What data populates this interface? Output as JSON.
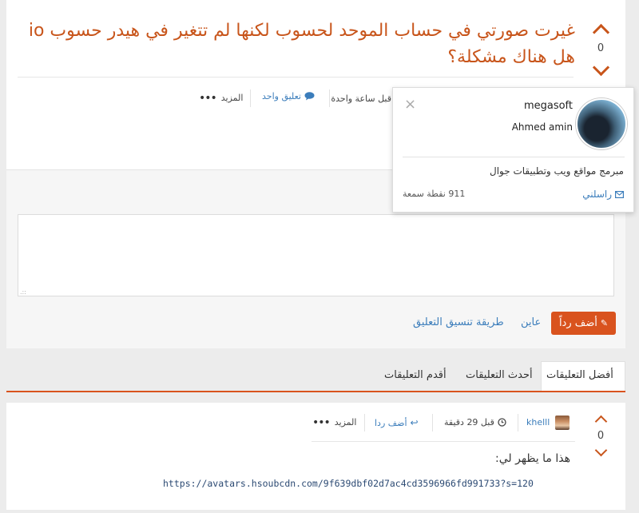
{
  "question": {
    "title": "غيرت صورتي في حساب الموحد لحسوب لكنها لم تتغير في هيدر حسوب io هل هناك مشكلة؟",
    "votes": "0",
    "time": "قبل ساعة واحدة",
    "comments_link": "تعليق واحد",
    "more_label": "المزيد"
  },
  "popup": {
    "username": "megasoft",
    "full_name": "Ahmed amin",
    "bio": "مبرمج مواقع ويب وتطبيقات جوال",
    "points": "911 نقطة سمعة",
    "message_link": "راسلني",
    "close": "×"
  },
  "reply_form": {
    "add_reply_label": "أضف رداً",
    "preview_link": "عاين",
    "format_link": "طريقة تنسيق التعليق",
    "resize_handle": ".::"
  },
  "tabs": {
    "best": "أفضل التعليقات",
    "newest": "أحدث التعليقات",
    "oldest": "أقدم التعليقات"
  },
  "comment": {
    "author": "khelll",
    "time": "قبل 29 دقيقة",
    "reply_label": "أضف ردا",
    "more_label": "المزيد",
    "votes": "0",
    "body": "هذا ما يظهر لي:",
    "link": "https://avatars.hsoubcdn.com/9f639dbf02d7ac4cd3596966fd991733?s=120"
  },
  "colors": {
    "accent": "#c8551b",
    "button": "#d9531e",
    "link": "#3b7dbb"
  }
}
